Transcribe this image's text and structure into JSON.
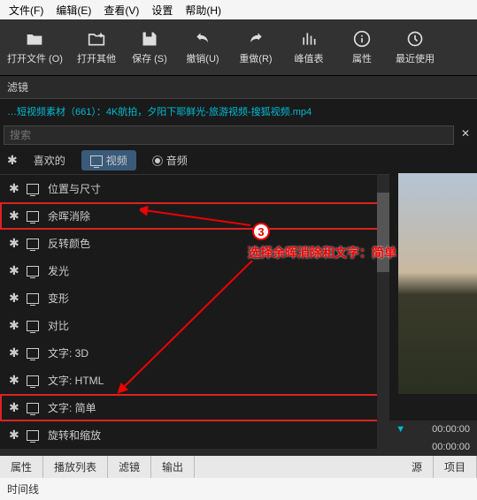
{
  "menu": {
    "file": "文件(F)",
    "edit": "编辑(E)",
    "view": "查看(V)",
    "settings": "设置",
    "help": "帮助(H)"
  },
  "toolbar": {
    "open_file": "打开文件 (O)",
    "open_other": "打开其他",
    "save": "保存 (S)",
    "undo": "撤销(U)",
    "redo": "重做(R)",
    "peak": "峰值表",
    "props": "属性",
    "recent": "最近使用"
  },
  "panel_title": "滤镜",
  "filename": "…短视频素材（661）：4K航拍，夕阳下耶鲜光-旅游视频-搜狐视频.mp4",
  "search_placeholder": "搜索",
  "tabs": {
    "fav": "喜欢的",
    "video": "视频",
    "audio": "音频"
  },
  "filters": [
    {
      "label": "位置与尺寸",
      "boxed": false
    },
    {
      "label": "余晖消除",
      "boxed": true
    },
    {
      "label": "反转颜色",
      "boxed": false
    },
    {
      "label": "发光",
      "boxed": false
    },
    {
      "label": "变形",
      "boxed": false
    },
    {
      "label": "对比",
      "boxed": false
    },
    {
      "label": "文字: 3D",
      "boxed": false
    },
    {
      "label": "文字: HTML",
      "boxed": false
    },
    {
      "label": "文字: 简单",
      "boxed": true
    },
    {
      "label": "旋转和缩放",
      "boxed": false
    }
  ],
  "annotation": {
    "num": "3",
    "text": "选择余晖消除和文字：简单"
  },
  "time": {
    "t1": "00:00:00",
    "t2": "00:00:00"
  },
  "bottom": {
    "props": "属性",
    "playlist": "播放列表",
    "filter": "滤镜",
    "output": "输出",
    "source": "源",
    "project": "项目"
  },
  "status": "时间线"
}
